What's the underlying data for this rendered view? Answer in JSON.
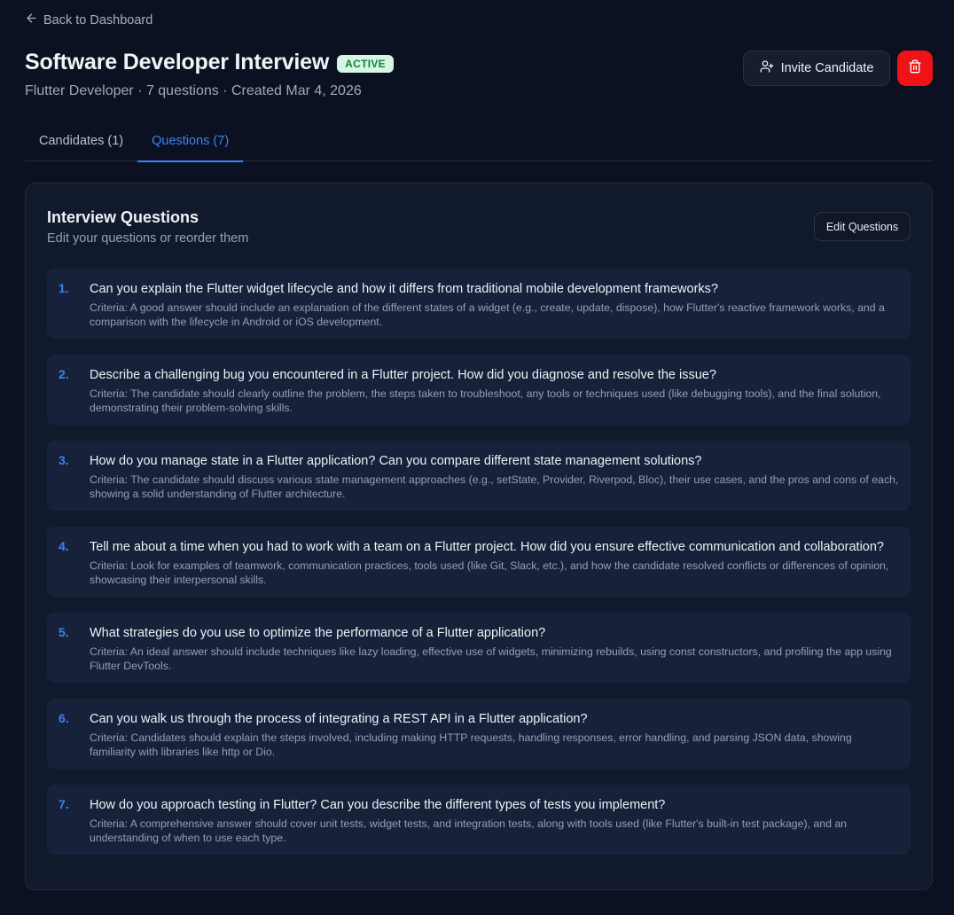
{
  "nav": {
    "back_label": "Back to Dashboard"
  },
  "header": {
    "title": "Software Developer Interview",
    "status": "ACTIVE",
    "role": "Flutter Developer",
    "question_count": "7 questions",
    "created": "Created Mar 4, 2026",
    "separator": " · ",
    "invite_label": "Invite Candidate"
  },
  "tabs": [
    {
      "label": "Candidates (1)",
      "active": false
    },
    {
      "label": "Questions (7)",
      "active": true
    }
  ],
  "panel": {
    "title": "Interview Questions",
    "description": "Edit your questions or reorder them",
    "edit_label": "Edit Questions"
  },
  "questions": [
    {
      "num": "1.",
      "text": "Can you explain the Flutter widget lifecycle and how it differs from traditional mobile development frameworks?",
      "criteria": "Criteria: A good answer should include an explanation of the different states of a widget (e.g., create, update, dispose), how Flutter's reactive framework works, and a comparison with the lifecycle in Android or iOS development."
    },
    {
      "num": "2.",
      "text": "Describe a challenging bug you encountered in a Flutter project. How did you diagnose and resolve the issue?",
      "criteria": "Criteria: The candidate should clearly outline the problem, the steps taken to troubleshoot, any tools or techniques used (like debugging tools), and the final solution, demonstrating their problem-solving skills."
    },
    {
      "num": "3.",
      "text": "How do you manage state in a Flutter application? Can you compare different state management solutions?",
      "criteria": "Criteria: The candidate should discuss various state management approaches (e.g., setState, Provider, Riverpod, Bloc), their use cases, and the pros and cons of each, showing a solid understanding of Flutter architecture."
    },
    {
      "num": "4.",
      "text": "Tell me about a time when you had to work with a team on a Flutter project. How did you ensure effective communication and collaboration?",
      "criteria": "Criteria: Look for examples of teamwork, communication practices, tools used (like Git, Slack, etc.), and how the candidate resolved conflicts or differences of opinion, showcasing their interpersonal skills."
    },
    {
      "num": "5.",
      "text": "What strategies do you use to optimize the performance of a Flutter application?",
      "criteria": "Criteria: An ideal answer should include techniques like lazy loading, effective use of widgets, minimizing rebuilds, using const constructors, and profiling the app using Flutter DevTools."
    },
    {
      "num": "6.",
      "text": "Can you walk us through the process of integrating a REST API in a Flutter application?",
      "criteria": "Criteria: Candidates should explain the steps involved, including making HTTP requests, handling responses, error handling, and parsing JSON data, showing familiarity with libraries like http or Dio."
    },
    {
      "num": "7.",
      "text": "How do you approach testing in Flutter? Can you describe the different types of tests you implement?",
      "criteria": "Criteria: A comprehensive answer should cover unit tests, widget tests, and integration tests, along with tools used (like Flutter's built-in test package), and an understanding of when to use each type."
    }
  ],
  "colors": {
    "background": "#0b1120",
    "accent": "#3b82f6",
    "danger": "#ef1318",
    "badge_bg": "#d6f5e3",
    "badge_text": "#15803d"
  },
  "icons": {
    "back": "arrow-left-icon",
    "invite": "user-plus-icon",
    "delete": "trash-icon"
  }
}
